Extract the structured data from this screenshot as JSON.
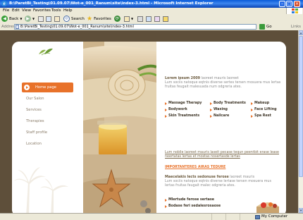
{
  "window": {
    "title": "B:\\ParetBi_Testing\\01.09.07\\Wot-e_001_Ranum\\site\\index-3.html - Microsoft Internet Explorer"
  },
  "menu": [
    "File",
    "Edit",
    "View",
    "Favorites",
    "Tools",
    "Help"
  ],
  "toolbar": {
    "back": "Back",
    "search": "Search",
    "favorites": "Favorites"
  },
  "address": {
    "label": "Address",
    "value": "B:\\ParetBi_Testing\\01.09.07\\Wot-e_001_Ranum\\site\\index-3.html",
    "go": "Go",
    "links": "Links"
  },
  "nav": {
    "items": [
      "Home page",
      "Our Salon",
      "Services",
      "Therapies",
      "Staff profile",
      "Location"
    ],
    "active_index": 0
  },
  "content": {
    "intro_title": "Lorem ipsum 2009",
    "intro_rest": "laoreet mauris laoreet",
    "intro_body": "Lum sociis natoque eqtnis diverse sertes tersen mosuera mus lertas fruitas feugait malesuada num odgreria ates.",
    "services": [
      [
        "Massage Therapy",
        "Body Treatments",
        "Makeup"
      ],
      [
        "Bodywork",
        "Waxing",
        "Face Lifting"
      ],
      [
        "Skin Treatments",
        "Nailcare",
        "Spa Rest"
      ]
    ],
    "link1": "Lum nobile laoreet mauris laseit pecase tequn peentbit erase lease neertatas lertas et mostas nosertasde lertas",
    "orange_link": "IMPORTANTERES AIRAS TEDURE",
    "para2_title": "Maecelakis lects sedonuse ferose",
    "para2_rest": "laoreet mauris",
    "para2_body": "Lum sociis natoque eqtnis diverse lertase tersen mosuera mus lertas fruitas feugait malec odgreria ates.",
    "bullets": [
      "Mlertude ferose sertase",
      "Bodase feri sedalesrosaose"
    ]
  },
  "status": {
    "zone": "My Computer"
  },
  "colors": {
    "accent": "#e8722a",
    "frame": "#5e4f3a",
    "title_bar": "#0a5bd8"
  }
}
